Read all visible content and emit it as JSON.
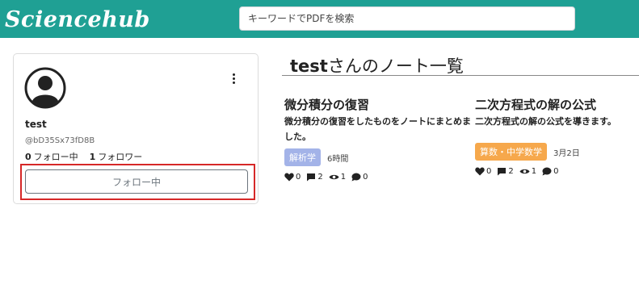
{
  "header": {
    "logo_text": "Sciencehub",
    "search": {
      "placeholder": "キーワードでPDFを検索"
    },
    "colors": {
      "header_bg": "#1fa094"
    }
  },
  "profile": {
    "username": "test",
    "handle": "@bD35Sx73fD8B",
    "following_count": "0",
    "following_label": "フォロー中",
    "followers_count": "1",
    "followers_label": "フォロワー",
    "follow_button_label": "フォロー中",
    "icons": {
      "avatar": "user-circle-icon",
      "menu": "vertical-ellipsis-icon"
    }
  },
  "notes_section": {
    "title_name": "test",
    "title_suffix": "さんのノート一覧",
    "notes": [
      {
        "title": "微分積分の復習",
        "description": "微分積分の復習をしたものをノートにまとめました。",
        "tag": "解析学",
        "tag_color": "#a3b3e8",
        "time": "6時間",
        "likes": "0",
        "comments": "2",
        "views": "1",
        "chats": "0"
      },
      {
        "title": "二次方程式の解の公式",
        "description": "二次方程式の解の公式を導きます。",
        "tag": "算数・中学数学",
        "tag_color": "#f6a84c",
        "time": "3月2日",
        "likes": "0",
        "comments": "2",
        "views": "1",
        "chats": "0"
      }
    ]
  }
}
